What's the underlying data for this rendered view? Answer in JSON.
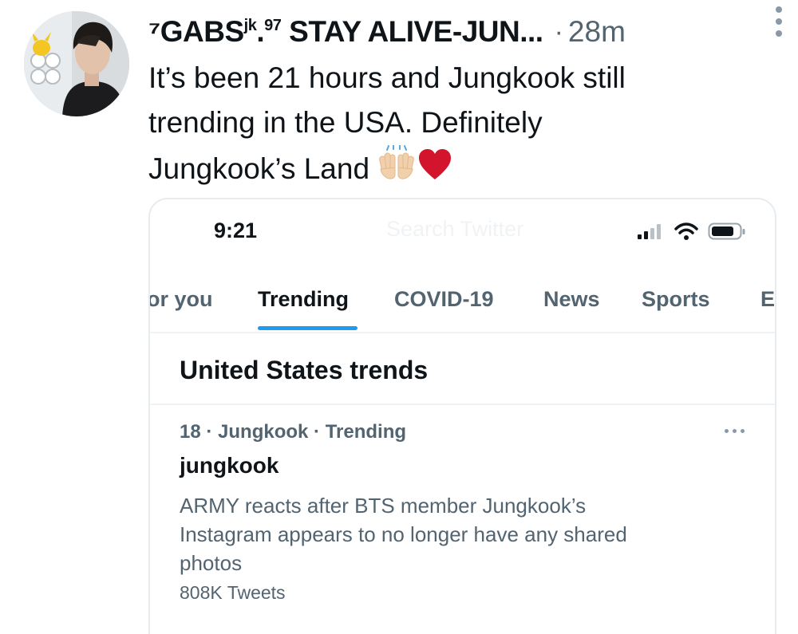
{
  "tweet": {
    "author": {
      "name_prefix": "⁷GABS",
      "name_sup": "jk",
      "name_mid": ".",
      "name_sup2": "97",
      "name_suffix": " STAY ALIVE-JUN...",
      "avatar_icon": "profile-photo"
    },
    "separator": "·",
    "time": "28m",
    "text_lines": [
      "It’s been 21 hours and Jungkook still",
      "trending in the USA. Definitely",
      "Jungkook’s Land"
    ],
    "emojis": [
      "raising-hands-icon",
      "red-heart-icon"
    ]
  },
  "screenshot": {
    "status_time": "9:21",
    "ghost_search": "Search Twitter",
    "status_icons": [
      "signal-icon",
      "wifi-icon",
      "battery-icon"
    ],
    "tabs": [
      {
        "label": "or you",
        "active": false
      },
      {
        "label": "Trending",
        "active": true
      },
      {
        "label": "COVID-19",
        "active": false
      },
      {
        "label": "News",
        "active": false
      },
      {
        "label": "Sports",
        "active": false
      },
      {
        "label": "E",
        "active": false
      }
    ],
    "section_title": "United States trends",
    "trend": {
      "meta": "18 · Jungkook · Trending",
      "name": "jungkook",
      "description_lines": [
        "ARMY reacts after BTS member Jungkook’s",
        "Instagram appears to no longer have any shared",
        "photos"
      ],
      "count": "808K Tweets"
    }
  },
  "colors": {
    "accent": "#1d9bf0",
    "secondary_text": "#536471",
    "primary_text": "#0f1419",
    "heart": "#d2142c"
  }
}
